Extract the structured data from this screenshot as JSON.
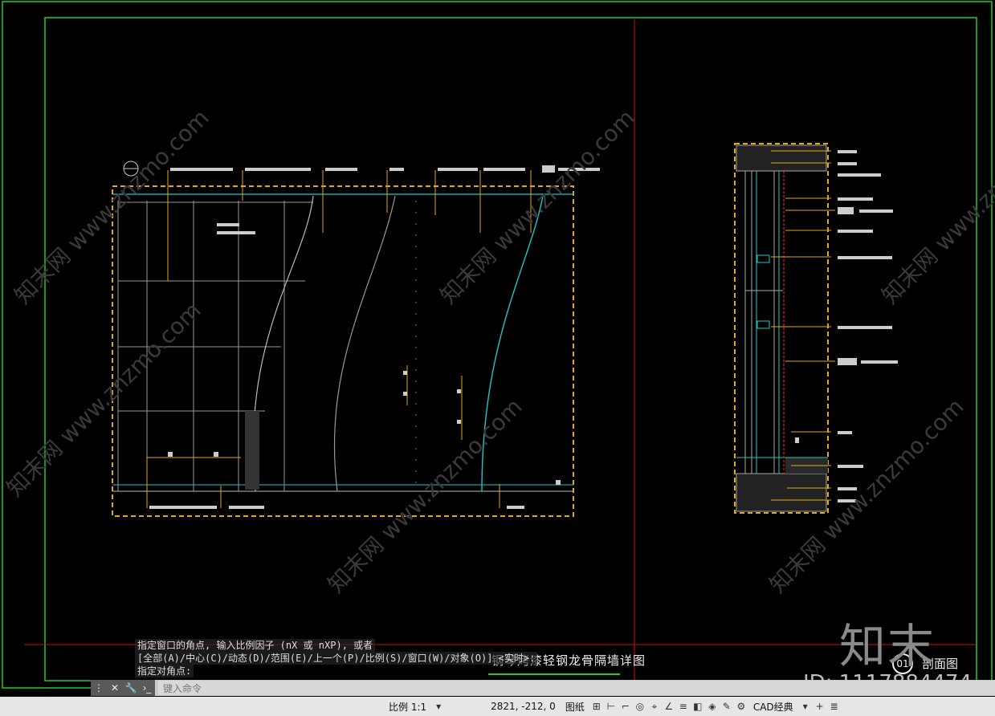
{
  "drawing": {
    "title": "钢琴烤漆轻钢龙骨隔墙详图",
    "section_number": "01",
    "section_label": "剖面图",
    "watermark_logo": "知末",
    "watermark_id": "ID: 1117884474",
    "watermark_text": "知末网 www.znzmo.com"
  },
  "command_history": [
    "指定窗口的角点, 输入比例因子 (nX 或 nXP), 或者",
    "[全部(A)/中心(C)/动态(D)/范围(E)/上一个(P)/比例(S)/窗口(W)/对象(O)] <实时>:",
    "指定对角点:"
  ],
  "command_line": {
    "placeholder": "键入命令",
    "close_icon": "close-icon",
    "settings_icon": "wrench-icon",
    "prompt_icon": "command-prompt-icon"
  },
  "status_bar": {
    "scale": "比例 1:1",
    "coords": "2821, -212, 0",
    "space": "图纸",
    "workspace": "CAD经典"
  },
  "colors": {
    "frame_green": "#22cc22",
    "divider_red": "#cc1111",
    "section_yellow": "#e6a817",
    "cyan": "#1ec8c8",
    "background": "#000000"
  }
}
